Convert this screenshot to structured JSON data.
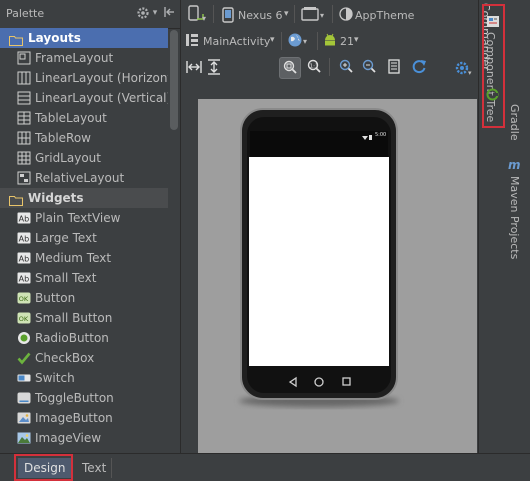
{
  "palette": {
    "title": "Palette",
    "categories": [
      {
        "label": "Layouts",
        "selected": true
      },
      {
        "label": "Widgets",
        "selected": false
      }
    ],
    "layouts": [
      "FrameLayout",
      "LinearLayout (Horizontal)",
      "LinearLayout (Vertical)",
      "TableLayout",
      "TableRow",
      "GridLayout",
      "RelativeLayout"
    ],
    "widgets": [
      "Plain TextView",
      "Large Text",
      "Medium Text",
      "Small Text",
      "Button",
      "Small Button",
      "RadioButton",
      "CheckBox",
      "Switch",
      "ToggleButton",
      "ImageButton",
      "ImageView"
    ]
  },
  "toolbar": {
    "device": "Nexus 6",
    "theme": "AppTheme",
    "activity": "MainActivity",
    "api_level": "21"
  },
  "phone": {
    "status_time": "5:00"
  },
  "right_strip": {
    "commander": "Commander",
    "component_tree": "Component Tree",
    "gradle": "Gradle",
    "maven": "Maven Projects"
  },
  "bottom_tabs": {
    "design": "Design",
    "text": "Text"
  },
  "colors": {
    "highlight": "#d3303b",
    "selection": "#4b6eaf",
    "android_green": "#a4c639"
  }
}
